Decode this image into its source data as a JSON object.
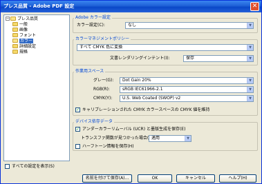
{
  "window": {
    "title": "プレス品質 - Adobe PDF 設定"
  },
  "tree": {
    "root": "プレス品質",
    "items": [
      "一般",
      "画像",
      "フォント",
      "カラー",
      "詳細設定",
      "規格"
    ],
    "selected_index": 3
  },
  "show_all": {
    "label": "すべての設定を表示(S)",
    "checked": false
  },
  "adobe_color": {
    "label": "Adobe カラー設定",
    "setting_label": "カラー設定(C):",
    "setting_value": "なし"
  },
  "color_mgmt": {
    "label": "カラーマネジメントポリシー",
    "policy_value": "すべて CMYK 色に変換",
    "intent_label": "文書レンダリングインテント(I):",
    "intent_value": "保存"
  },
  "working_space": {
    "label": "作業用スペース",
    "rows": [
      {
        "label": "グレー(G):",
        "value": "Dot Gain 20%"
      },
      {
        "label": "RGB(R):",
        "value": "sRGB IEC61966-2.1"
      },
      {
        "label": "CMYK(Y):",
        "value": "U.S. Web Coated (SWOP) v2"
      }
    ],
    "preserve_label": "キャリブレーションされた CMYK カラースペースの CMYK 値を維持",
    "preserve_checked": true
  },
  "device_data": {
    "label": "デバイス依存データ",
    "ucr_label": "アンダーカラーリムーバル (UCR) と墨版生成を保存(E)",
    "ucr_checked": true,
    "transfer_label": "トランスファ関数が見つかった場合(T):",
    "transfer_value": "適用",
    "halftone_label": "ハーフトーン情報を保存(H)",
    "halftone_checked": false
  },
  "buttons": {
    "save_as": "名前を付けて保存(A)...",
    "ok": "OK",
    "cancel": "キャンセル",
    "help": "ヘルプ(H)"
  },
  "colors": {
    "title_bar": "#0a48c8",
    "group_label": "#0046d5",
    "selection": "#316ac5"
  }
}
